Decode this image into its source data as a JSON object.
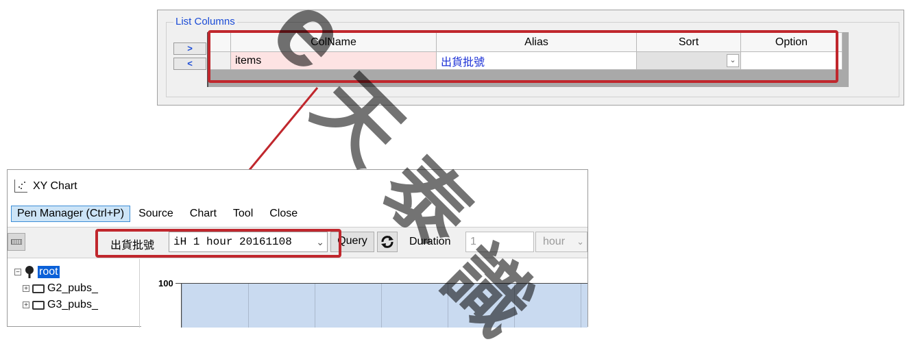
{
  "list_columns": {
    "title": "List Columns",
    "move_right_label": ">",
    "move_left_label": "<",
    "headers": [
      "ColName",
      "Alias",
      "Sort",
      "Option"
    ],
    "rows": [
      {
        "colname": "items",
        "alias": "出貨批號",
        "sort": "",
        "option": ""
      }
    ]
  },
  "xy_chart": {
    "window_title": "XY Chart",
    "menu": [
      "Pen Manager (Ctrl+P)",
      "Source",
      "Chart",
      "Tool",
      "Close"
    ],
    "toolbar": {
      "filter_label": "出貨批號",
      "filter_value": "iH 1 hour 20161108",
      "query_label": "Query",
      "duration_label": "Duration",
      "duration_value": "1",
      "duration_unit": "hour"
    },
    "tree": {
      "root": "root",
      "items": [
        "G2_pubs_",
        "G3_pubs_"
      ]
    },
    "y_max_tick": "100"
  },
  "watermark": [
    "e",
    "天",
    "泰",
    "識"
  ],
  "colors": {
    "highlight": "#c0272d",
    "accent": "#1a4bd6",
    "root_selected": "#0a60d8",
    "plot_bg": "#c9daf0"
  }
}
